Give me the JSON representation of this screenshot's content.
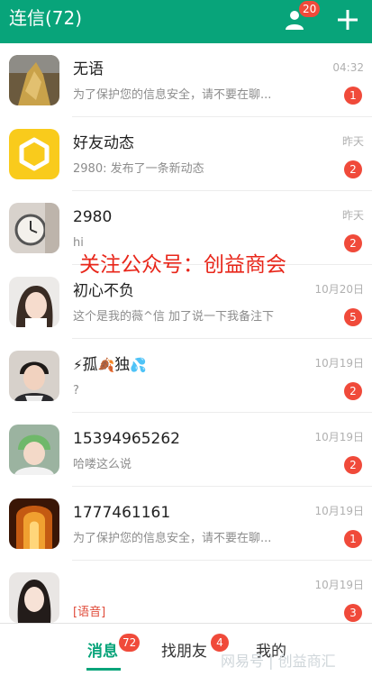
{
  "header": {
    "title": "连信(72)",
    "contacts_badge": "20"
  },
  "conversations": [
    {
      "name": "无语",
      "preview": "为了保护您的信息安全，请不要在聊...",
      "time": "04:32",
      "badge": "1"
    },
    {
      "name": "好友动态",
      "preview": "2980: 发布了一条新动态",
      "time": "昨天",
      "badge": "2"
    },
    {
      "name": "2980",
      "preview": "hi",
      "time": "昨天",
      "badge": "2"
    },
    {
      "name": "初心不负",
      "preview": "这个是我的薇^信 加了说一下我备注下",
      "time": "10月20日",
      "badge": "5"
    },
    {
      "name_prefix": "⚡",
      "name": "孤",
      "name_mid": "🍂",
      "name_end": "独",
      "name_suffix": "💦",
      "preview": "?",
      "time": "10月19日",
      "badge": "2"
    },
    {
      "name": "15394965262",
      "preview": "哈喽这么说",
      "time": "10月19日",
      "badge": "2"
    },
    {
      "name": "1777461161",
      "preview": "为了保护您的信息安全，请不要在聊...",
      "time": "10月19日",
      "badge": "1"
    },
    {
      "name": "",
      "preview": "[语音]",
      "time": "10月19日",
      "badge": "3"
    }
  ],
  "watermark": "关注公众号：创益商会",
  "bottom_nav": {
    "tabs": [
      {
        "label": "消息",
        "badge": "72"
      },
      {
        "label": "找朋友",
        "badge": "4"
      },
      {
        "label": "我的"
      }
    ],
    "footer_mark": "网易号 | 创益商汇"
  },
  "colors": {
    "brand": "#08a47a",
    "badge": "#f04a3a",
    "watermark": "#e8261a"
  }
}
